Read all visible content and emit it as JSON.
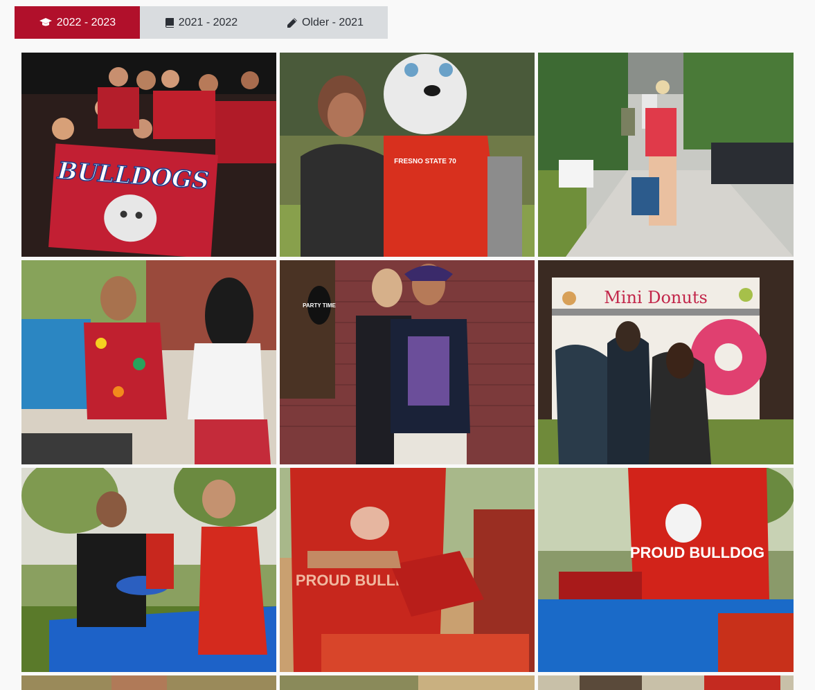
{
  "tabs": [
    {
      "label": "2022 - 2023",
      "icon": "graduation-cap-icon",
      "active": true
    },
    {
      "label": "2021 - 2022",
      "icon": "book-icon",
      "active": false
    },
    {
      "label": "Older - 2021",
      "icon": "pencil-icon",
      "active": false
    }
  ],
  "photos": [
    {
      "label": "BULLDOGS",
      "scene": "bulldogs-flag-crowd"
    },
    {
      "label": "FRESNO STATE 70",
      "scene": "mascot-selfie"
    },
    {
      "label": "",
      "scene": "move-in-walk"
    },
    {
      "label": "",
      "scene": "shaved-ice-hawaiian"
    },
    {
      "label": "PARTY TIME",
      "scene": "friends-posing-brick-wall"
    },
    {
      "label": "Mini Donuts",
      "scene": "mini-donuts-truck"
    },
    {
      "label": "",
      "scene": "shirt-giveaway-table"
    },
    {
      "label": "PROUD BULLDOG",
      "scene": "red-shirt-folding"
    },
    {
      "label": "PROUD BULLDOG",
      "scene": "red-shirt-stack"
    },
    {
      "label": "",
      "scene": "partial-row-1"
    },
    {
      "label": "",
      "scene": "partial-row-2"
    },
    {
      "label": "",
      "scene": "partial-row-3"
    }
  ],
  "colors": {
    "accent": "#b1102b",
    "tab_inactive": "#d9dcdf",
    "page_bg": "#f9f9f9"
  }
}
